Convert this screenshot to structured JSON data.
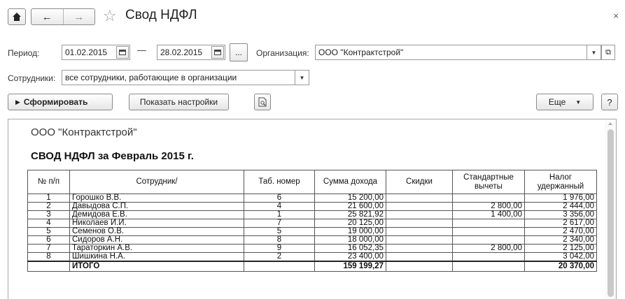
{
  "window": {
    "title": "Свод НДФЛ",
    "close_glyph": "×"
  },
  "nav": {
    "home_glyph": "🠅",
    "back_glyph": "←",
    "forward_glyph": "→",
    "star_glyph": "☆"
  },
  "filters": {
    "period_label": "Период:",
    "date_from": "01.02.2015",
    "date_to": "28.02.2015",
    "dash": "—",
    "dots_label": "...",
    "org_label": "Организация:",
    "org_value": "ООО \"Контрактстрой\"",
    "employees_label": "Сотрудники:",
    "employees_value": "все сотрудники, работающие в организации"
  },
  "toolbar": {
    "generate_label": "Сформировать",
    "settings_label": "Показать настройки",
    "more_label": "Еще",
    "help_label": "?"
  },
  "report": {
    "org_name": "ООО \"Контрактстрой\"",
    "title": "СВОД НДФЛ за Февраль 2015 г.",
    "columns": [
      "№ п/п",
      "Сотрудник/",
      "Таб. номер",
      "Сумма дохода",
      "Скидки",
      "Стандартные вычеты",
      "Налог удержанный"
    ],
    "rows": [
      {
        "n": "1",
        "name": "Горошко В.В.",
        "tab": "6",
        "income": "15 200,00",
        "discount": "",
        "deduction": "",
        "tax": "1 976,00"
      },
      {
        "n": "2",
        "name": "Давыдова С.П.",
        "tab": "4",
        "income": "21 600,00",
        "discount": "",
        "deduction": "2 800,00",
        "tax": "2 444,00"
      },
      {
        "n": "3",
        "name": "Демидова Е.В.",
        "tab": "1",
        "income": "25 821,92",
        "discount": "",
        "deduction": "1 400,00",
        "tax": "3 356,00"
      },
      {
        "n": "4",
        "name": "Николаев И.И.",
        "tab": "7",
        "income": "20 125,00",
        "discount": "",
        "deduction": "",
        "tax": "2 617,00"
      },
      {
        "n": "5",
        "name": "Семенов О.В.",
        "tab": "5",
        "income": "19 000,00",
        "discount": "",
        "deduction": "",
        "tax": "2 470,00"
      },
      {
        "n": "6",
        "name": "Сидоров А.Н.",
        "tab": "8",
        "income": "18 000,00",
        "discount": "",
        "deduction": "",
        "tax": "2 340,00"
      },
      {
        "n": "7",
        "name": "Тараторкин А.В.",
        "tab": "9",
        "income": "16 052,35",
        "discount": "",
        "deduction": "2 800,00",
        "tax": "2 125,00"
      },
      {
        "n": "8",
        "name": "Шишкина Н.А.",
        "tab": "2",
        "income": "23 400,00",
        "discount": "",
        "deduction": "",
        "tax": "3 042,00"
      }
    ],
    "total": {
      "label": "ИТОГО",
      "income": "159 199,27",
      "tax": "20 370,00"
    }
  }
}
